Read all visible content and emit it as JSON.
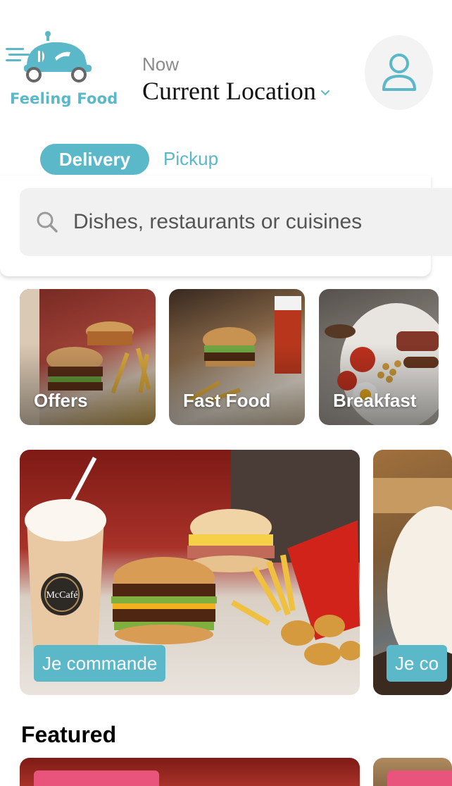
{
  "header": {
    "logo_text": "Feeling Food",
    "time_label": "Now",
    "location": "Current Location"
  },
  "mode_tabs": {
    "delivery": "Delivery",
    "pickup": "Pickup"
  },
  "search": {
    "placeholder": "Dishes, restaurants or cuisines"
  },
  "categories": [
    {
      "label": "Offers"
    },
    {
      "label": "Fast Food"
    },
    {
      "label": "Breakfast"
    }
  ],
  "promos": [
    {
      "button": "Je commande",
      "brand_badge": "McCafé"
    },
    {
      "button": "Je co"
    }
  ],
  "featured": {
    "title": "Featured"
  },
  "colors": {
    "accent": "#5bb8c9",
    "search_bg": "#f1f1f1",
    "pink_badge": "#e8547c"
  },
  "icons": [
    "logo-delivery-truck-icon",
    "chevron-down-icon",
    "user-icon",
    "search-icon"
  ]
}
